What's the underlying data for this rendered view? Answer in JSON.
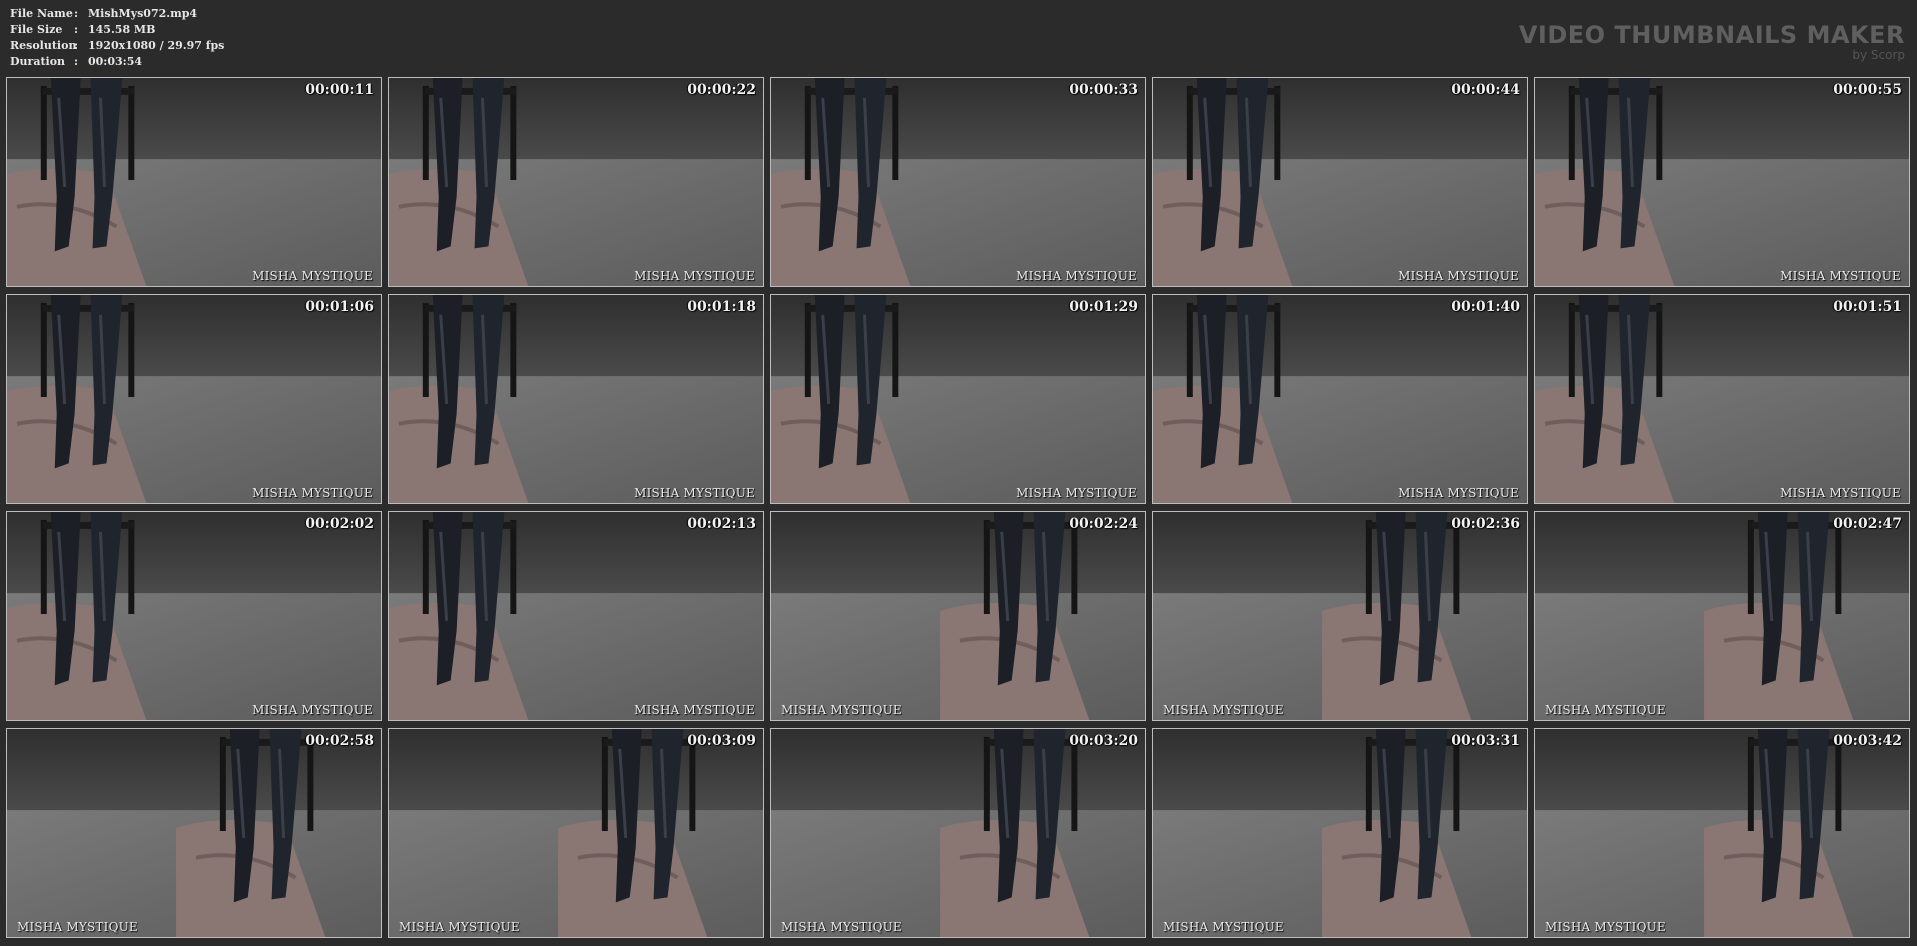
{
  "file_info": [
    {
      "key": "File Name",
      "value": "MishMys072.mp4"
    },
    {
      "key": "File Size",
      "value": "145.58 MB"
    },
    {
      "key": "Resolution",
      "value": "1920x1080 / 29.97 fps"
    },
    {
      "key": "Duration",
      "value": "00:03:54"
    }
  ],
  "separator": ":",
  "brand": {
    "title": "VIDEO THUMBNAILS MAKER",
    "subtitle": "by Scorp"
  },
  "watermark": "MISHA MYSTIQUE",
  "thumbnails": [
    {
      "time": "00:00:11",
      "side": "left"
    },
    {
      "time": "00:00:22",
      "side": "left"
    },
    {
      "time": "00:00:33",
      "side": "left"
    },
    {
      "time": "00:00:44",
      "side": "left"
    },
    {
      "time": "00:00:55",
      "side": "left"
    },
    {
      "time": "00:01:06",
      "side": "left"
    },
    {
      "time": "00:01:18",
      "side": "left"
    },
    {
      "time": "00:01:29",
      "side": "left"
    },
    {
      "time": "00:01:40",
      "side": "left"
    },
    {
      "time": "00:01:51",
      "side": "left"
    },
    {
      "time": "00:02:02",
      "side": "left"
    },
    {
      "time": "00:02:13",
      "side": "left"
    },
    {
      "time": "00:02:24",
      "side": "right"
    },
    {
      "time": "00:02:36",
      "side": "right"
    },
    {
      "time": "00:02:47",
      "side": "right"
    },
    {
      "time": "00:02:58",
      "side": "right"
    },
    {
      "time": "00:03:09",
      "side": "right"
    },
    {
      "time": "00:03:20",
      "side": "right"
    },
    {
      "time": "00:03:31",
      "side": "right"
    },
    {
      "time": "00:03:42",
      "side": "right"
    }
  ],
  "colors": {
    "background": "#2b2b2b",
    "thumb_border": "#bdbdbd",
    "brand": "#5f5f5f"
  }
}
